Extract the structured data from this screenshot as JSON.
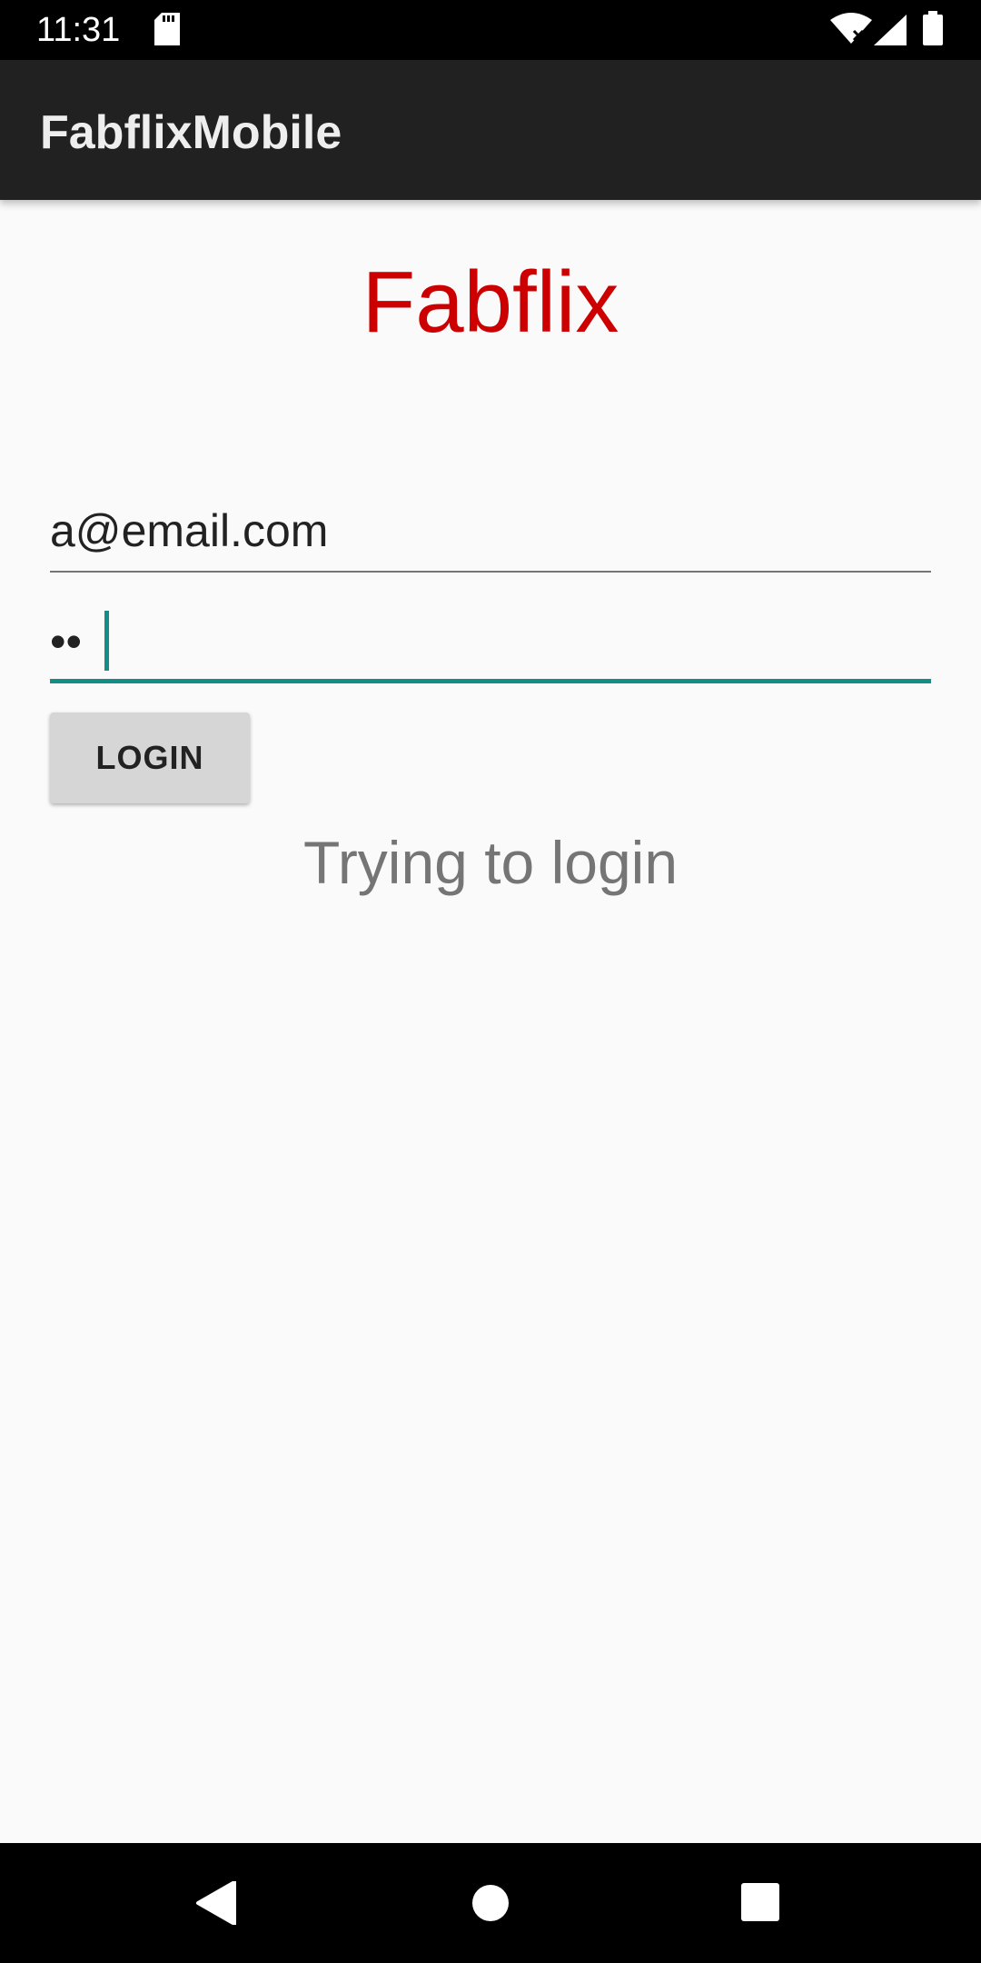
{
  "status_bar": {
    "time": "11:31",
    "icons": [
      "sd-card-icon",
      "wifi-icon",
      "signal-icon",
      "battery-icon"
    ]
  },
  "app_bar": {
    "title": "FabflixMobile"
  },
  "login": {
    "brand": "Fabflix",
    "brand_color": "#cc0000",
    "email_value": "a@email.com",
    "password_value": "••",
    "button_label": "LOGIN",
    "status_message": "Trying to login",
    "accent_color": "#138d85"
  },
  "nav_bar": {
    "icons": [
      "back-icon",
      "home-icon",
      "recents-icon"
    ]
  }
}
